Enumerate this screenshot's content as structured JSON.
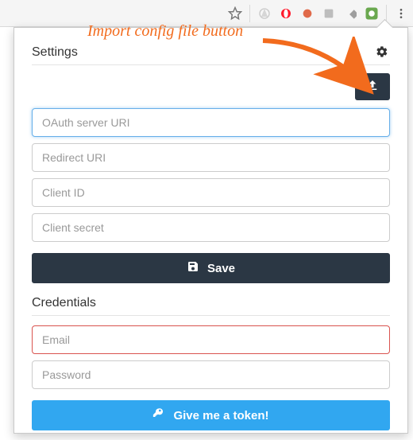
{
  "annotation": {
    "label": "Import config file button"
  },
  "browser_bar": {
    "icons": [
      "star-icon",
      "extensions-icon",
      "opera-icon",
      "circle-icon",
      "grid-icon",
      "diamond-icon",
      "app-icon",
      "menu-icon"
    ]
  },
  "settings": {
    "header_title": "Settings",
    "fields": {
      "oauth_server_uri": {
        "placeholder": "OAuth server URI",
        "state": "focus"
      },
      "redirect_uri": {
        "placeholder": "Redirect URI"
      },
      "client_id": {
        "placeholder": "Client ID"
      },
      "client_secret": {
        "placeholder": "Client secret"
      }
    },
    "save_label": "Save"
  },
  "credentials": {
    "header_title": "Credentials",
    "fields": {
      "email": {
        "placeholder": "Email",
        "state": "error"
      },
      "password": {
        "placeholder": "Password"
      }
    },
    "token_button_label": "Give me a token!"
  },
  "colors": {
    "dark": "#2b3744",
    "blue": "#31a7f0",
    "accent_orange": "#f26b1d",
    "error": "#d9534f",
    "focus": "#66afe9"
  }
}
